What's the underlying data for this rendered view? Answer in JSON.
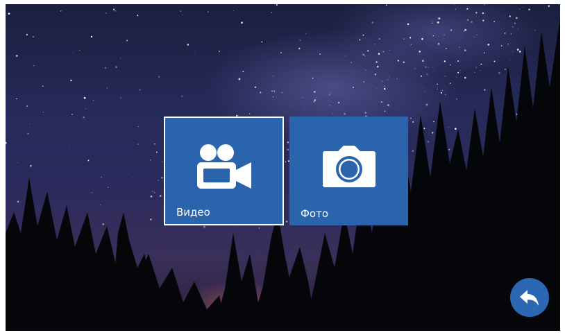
{
  "menu": {
    "items": [
      {
        "label": "Видео",
        "icon": "video-camera-icon",
        "selected": true
      },
      {
        "label": "Фото",
        "icon": "photo-camera-icon",
        "selected": false
      }
    ]
  },
  "navigation": {
    "back_icon": "back-arrow-icon"
  },
  "colors": {
    "tile": "#2a64ad",
    "selection_border": "#ffffff",
    "back_button": "#2c67b3"
  }
}
